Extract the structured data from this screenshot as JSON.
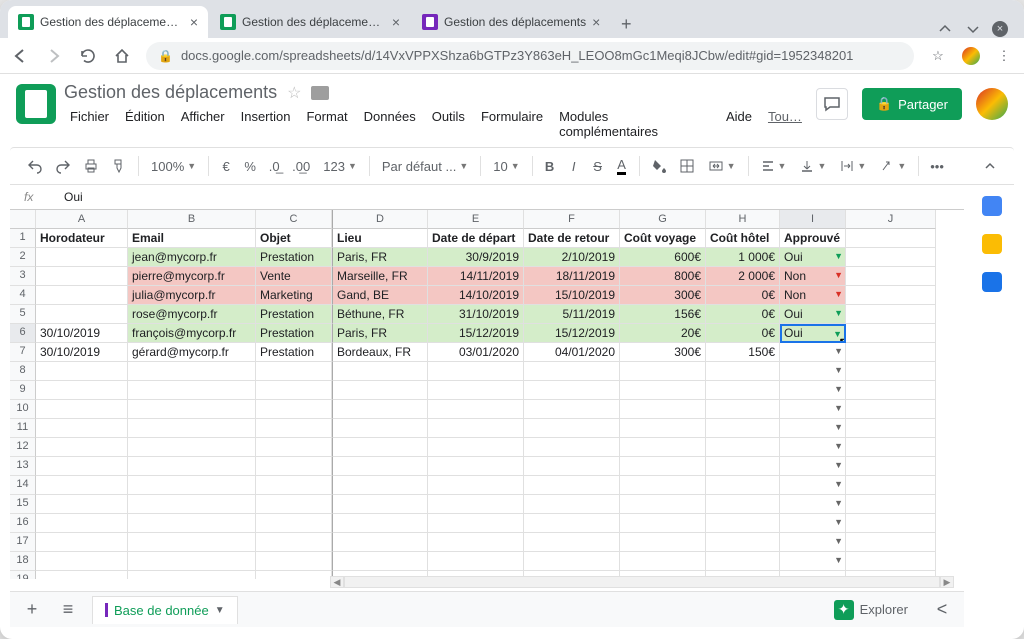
{
  "browser": {
    "tabs": [
      {
        "title": "Gestion des déplacements - G",
        "fav": "green"
      },
      {
        "title": "Gestion des déplacements - G",
        "fav": "green"
      },
      {
        "title": "Gestion des déplacements",
        "fav": "purple"
      }
    ],
    "url": "docs.google.com/spreadsheets/d/14VxVPPXShza6bGTPz3Y863eH_LEOO8mGc1Meqi8JCbw/edit#gid=1952348201"
  },
  "doc": {
    "title": "Gestion des déplacements",
    "menus": [
      "Fichier",
      "Édition",
      "Afficher",
      "Insertion",
      "Format",
      "Données",
      "Outils",
      "Formulaire",
      "Modules complémentaires",
      "Aide"
    ],
    "menu_trunc": "Tou…",
    "share": "Partager"
  },
  "toolbar": {
    "zoom": "100%",
    "currency": "€",
    "pct": "%",
    "dec0": ".0",
    "dec00": ".00",
    "numfmt": "123",
    "font": "Par défaut ...",
    "size": "10",
    "more": "•••"
  },
  "fx": {
    "label": "fx",
    "value": "Oui"
  },
  "columns": [
    "A",
    "B",
    "C",
    "D",
    "E",
    "F",
    "G",
    "H",
    "I",
    "J"
  ],
  "headers": [
    "Horodateur",
    "Email",
    "Objet",
    "Lieu",
    "Date de départ",
    "Date de retour",
    "Coût voyage",
    "Coût hôtel",
    "Approuvé"
  ],
  "rows": [
    {
      "n": 2,
      "ts": "",
      "email": "jean@mycorp.fr",
      "objet": "Prestation",
      "lieu": "Paris, FR",
      "dep": "30/9/2019",
      "ret": "2/10/2019",
      "voy": "600€",
      "hot": "1 000€",
      "app": "Oui",
      "color": "green"
    },
    {
      "n": 3,
      "ts": "",
      "email": "pierre@mycorp.fr",
      "objet": "Vente",
      "lieu": "Marseille, FR",
      "dep": "14/11/2019",
      "ret": "18/11/2019",
      "voy": "800€",
      "hot": "2 000€",
      "app": "Non",
      "color": "red"
    },
    {
      "n": 4,
      "ts": "",
      "email": "julia@mycorp.fr",
      "objet": "Marketing",
      "lieu": "Gand, BE",
      "dep": "14/10/2019",
      "ret": "15/10/2019",
      "voy": "300€",
      "hot": "0€",
      "app": "Non",
      "color": "red"
    },
    {
      "n": 5,
      "ts": "",
      "email": "rose@mycorp.fr",
      "objet": "Prestation",
      "lieu": "Béthune, FR",
      "dep": "31/10/2019",
      "ret": "5/11/2019",
      "voy": "156€",
      "hot": "0€",
      "app": "Oui",
      "color": "green"
    },
    {
      "n": 6,
      "ts": "30/10/2019",
      "email": "françois@mycorp.fr",
      "objet": "Prestation",
      "lieu": "Paris, FR",
      "dep": "15/12/2019",
      "ret": "15/12/2019",
      "voy": "20€",
      "hot": "0€",
      "app": "Oui",
      "color": "green",
      "active_app": true
    },
    {
      "n": 7,
      "ts": "30/10/2019",
      "email": "gérard@mycorp.fr",
      "objet": "Prestation",
      "lieu": "Bordeaux, FR",
      "dep": "03/01/2020",
      "ret": "04/01/2020",
      "voy": "300€",
      "hot": "150€",
      "app": "",
      "color": ""
    }
  ],
  "empty_rows": [
    8,
    9,
    10,
    11,
    12,
    13,
    14,
    15,
    16,
    17,
    18,
    19
  ],
  "sheet_tab": "Base de donnée",
  "explore": "Explorer",
  "active_cell": "I6"
}
